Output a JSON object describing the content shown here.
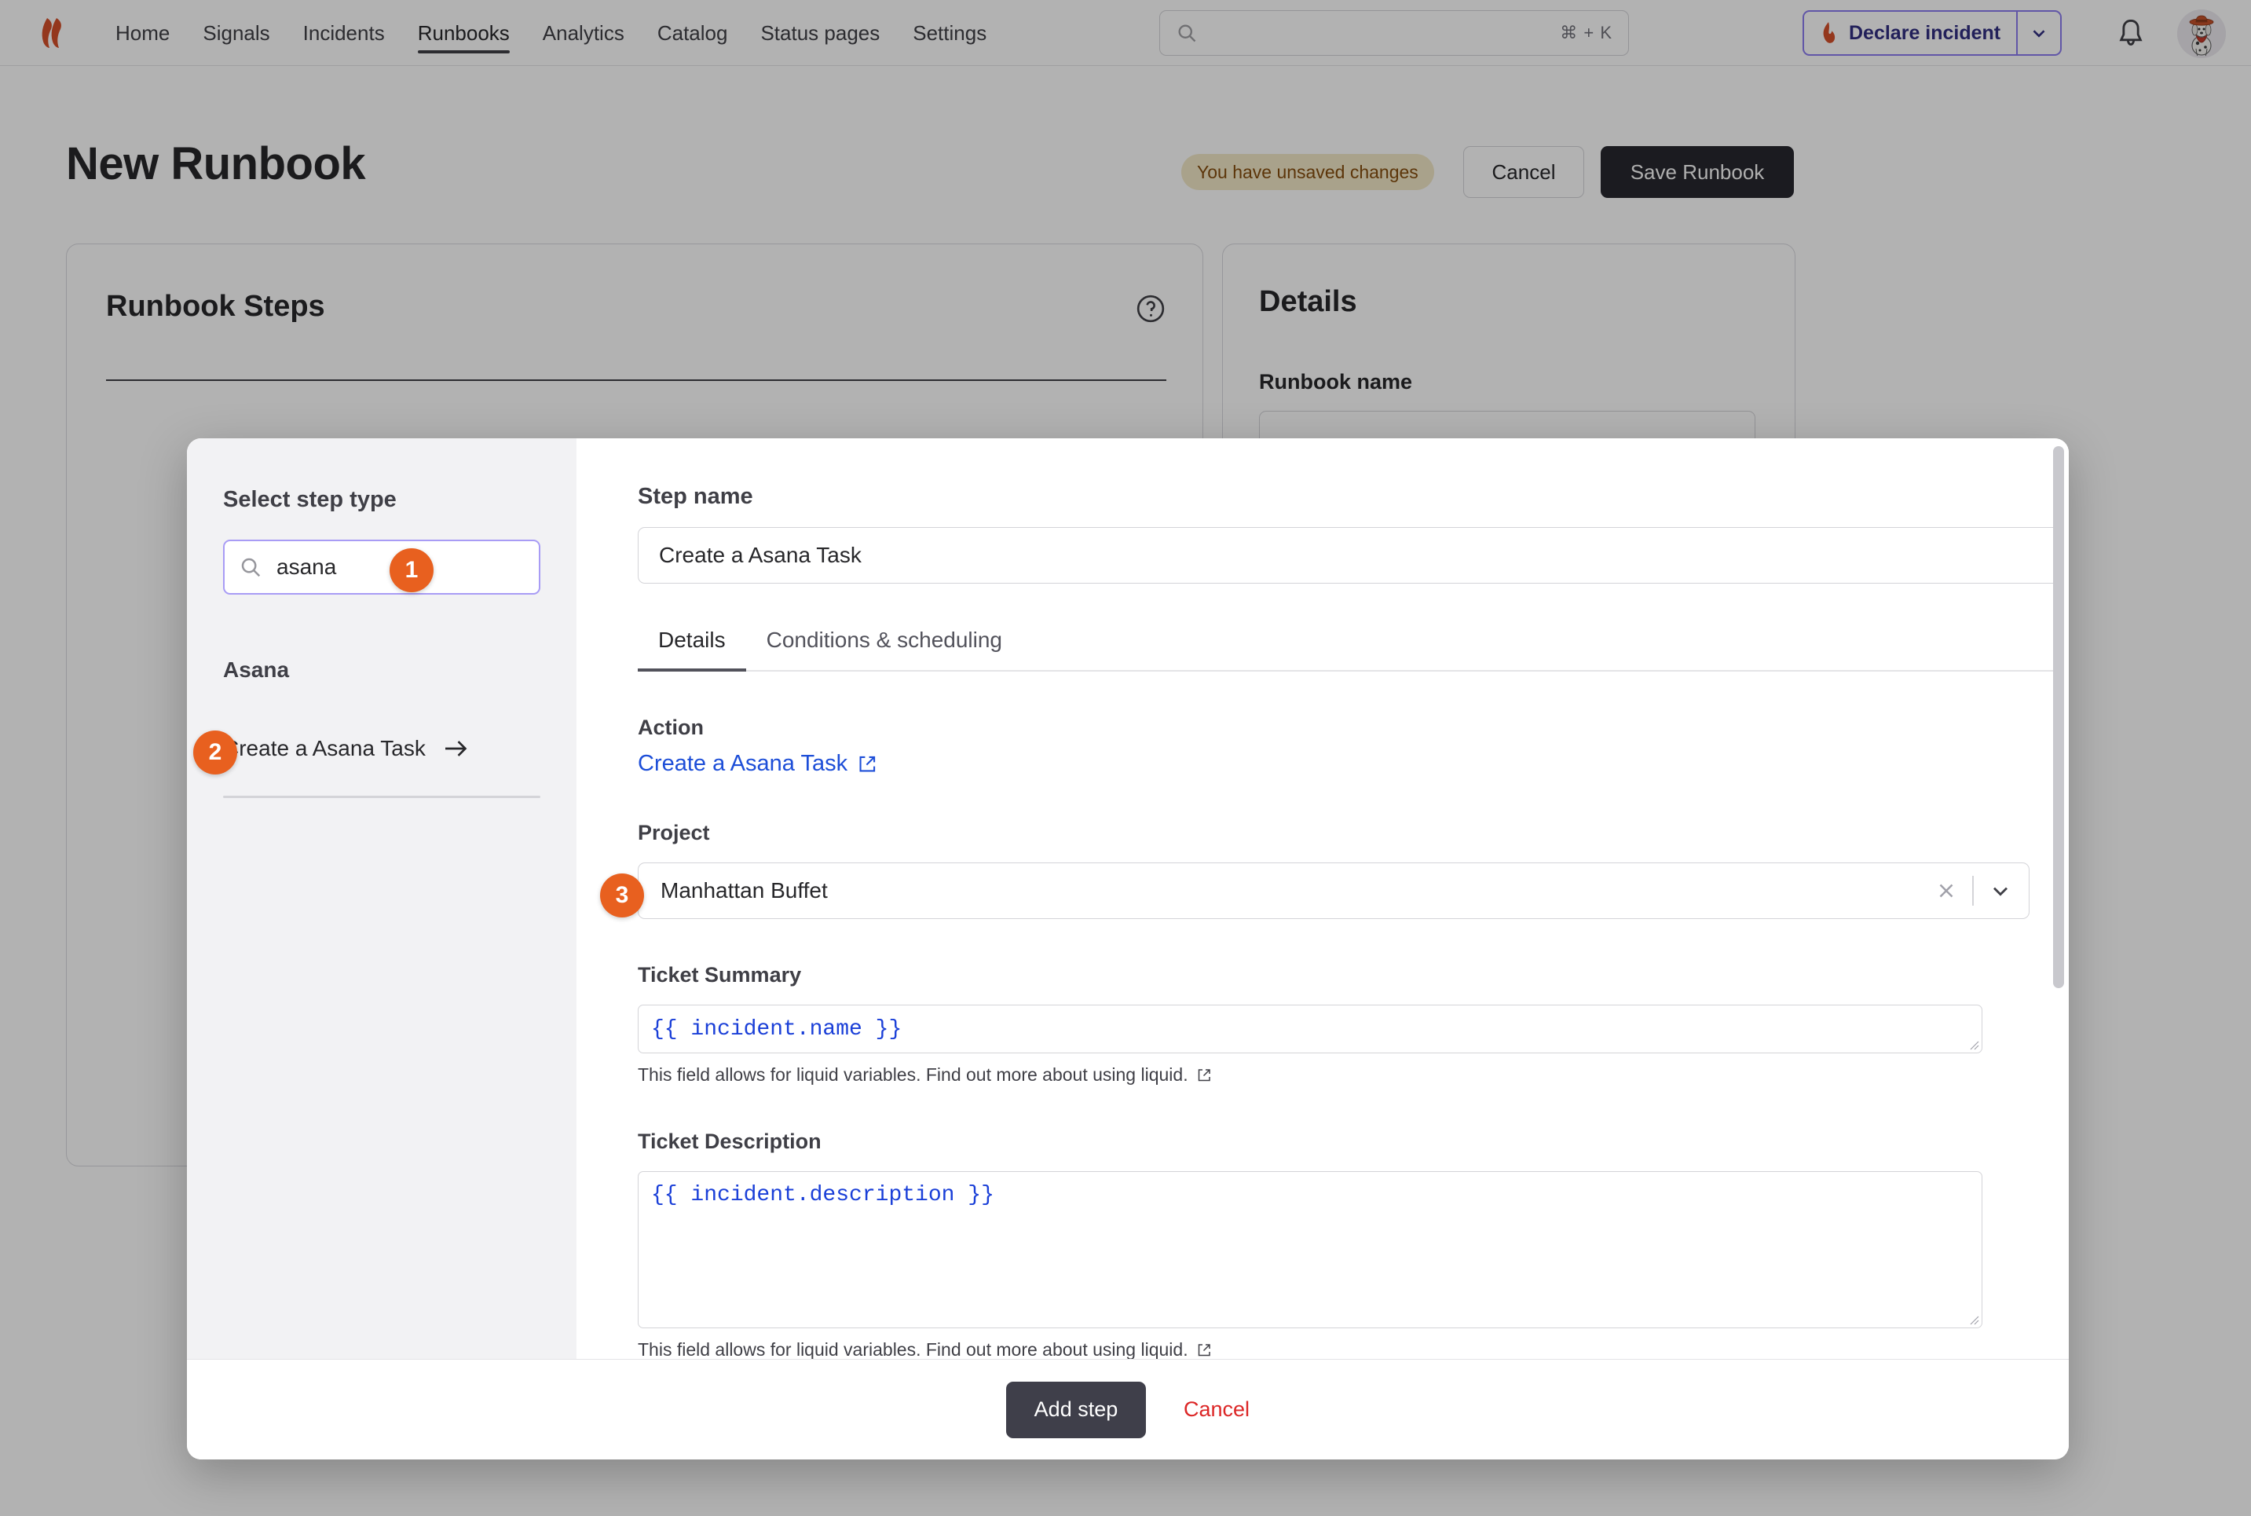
{
  "nav": {
    "logo_icon": "incident-io-flame-logo",
    "items": [
      {
        "label": "Home",
        "active": false
      },
      {
        "label": "Signals",
        "active": false
      },
      {
        "label": "Incidents",
        "active": false
      },
      {
        "label": "Runbooks",
        "active": true
      },
      {
        "label": "Analytics",
        "active": false
      },
      {
        "label": "Catalog",
        "active": false
      },
      {
        "label": "Status pages",
        "active": false
      },
      {
        "label": "Settings",
        "active": false
      }
    ],
    "search": {
      "placeholder": "",
      "value": "",
      "shortcut": "⌘ + K",
      "icon": "search-icon"
    },
    "declare_incident": {
      "label": "Declare incident",
      "icon": "flame-icon",
      "caret_icon": "chevron-down-icon"
    },
    "bell_icon": "notification-bell-icon",
    "avatar_icon": "user-avatar-dalmatian-dog"
  },
  "page": {
    "title": "New Runbook",
    "unsaved_badge": "You have unsaved changes",
    "cancel_label": "Cancel",
    "save_label": "Save Runbook"
  },
  "cards": {
    "steps": {
      "title": "Runbook Steps",
      "help_icon": "question-circle-icon"
    },
    "details": {
      "title": "Details",
      "runbook_name_label": "Runbook name",
      "runbook_name_value": "",
      "runbook_name_placeholder": ""
    }
  },
  "modal": {
    "sidebar": {
      "heading": "Select step type",
      "search": {
        "value": "asana",
        "placeholder": "",
        "icon": "search-icon"
      },
      "group_heading": "Asana",
      "options": [
        {
          "label": "Create a Asana Task",
          "arrow_icon": "arrow-right-icon"
        }
      ]
    },
    "main": {
      "step_name_label": "Step name",
      "step_name_value": "Create a Asana Task",
      "step_name_placeholder": "",
      "tabs": [
        {
          "label": "Details",
          "active": true
        },
        {
          "label": "Conditions & scheduling",
          "active": false
        }
      ],
      "action_label": "Action",
      "action_link": "Create a Asana Task",
      "action_link_icon": "external-link-icon",
      "project_label": "Project",
      "project_value": "Manhattan Buffet",
      "project_clear_icon": "close-x-icon",
      "project_caret_icon": "chevron-down-icon",
      "ticket_summary_label": "Ticket Summary",
      "ticket_summary_value": "{{ incident.name }}",
      "ticket_summary_helper": "This field allows for liquid variables. Find out more about using liquid.",
      "ticket_description_label": "Ticket Description",
      "ticket_description_value": "{{ incident.description }}",
      "ticket_description_helper": "This field allows for liquid variables. Find out more about using liquid.",
      "helper_link_icon": "external-link-icon"
    },
    "footer": {
      "add_step_label": "Add step",
      "cancel_label": "Cancel"
    }
  },
  "annotations": [
    {
      "number": "1",
      "target": "step-type-search-input"
    },
    {
      "number": "2",
      "target": "step-type-option-create-asana-task"
    },
    {
      "number": "3",
      "target": "project-select"
    }
  ],
  "colors": {
    "accent_orange": "#e8601f",
    "brand_purple": "#8b7cf0",
    "link_blue": "#1d4ed8",
    "liquid_blue": "#1a3fd8",
    "danger_red": "#dc2626",
    "dark_button": "#27272e",
    "warning_bg": "#f3e8c8",
    "warning_text": "#854d0e"
  }
}
